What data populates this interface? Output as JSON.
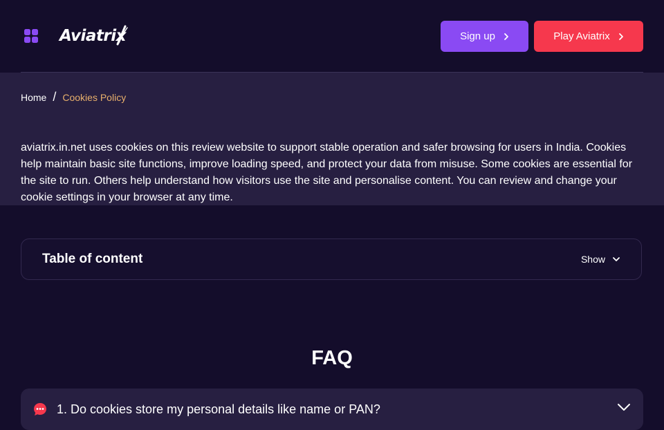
{
  "header": {
    "logo_text": "Aviatrix",
    "signup_label": "Sign up",
    "play_label": "Play Aviatrix"
  },
  "breadcrumb": {
    "home": "Home",
    "separator": "/",
    "current": "Cookies Policy"
  },
  "intro_text": "aviatrix.in.net uses cookies on this review website to support stable operation and safer browsing for users in India. Cookies help maintain basic site functions, improve loading speed, and protect your data from misuse. Some cookies are essential for the site to run. Others help understand how visitors use the site and personalise content. You can review and change your cookie settings in your browser at any time.",
  "toc": {
    "title": "Table of content",
    "toggle_label": "Show"
  },
  "faq": {
    "title": "FAQ",
    "items": [
      {
        "question": "1. Do cookies store my personal details like name or PAN?",
        "icon": "chat-bubble-icon"
      }
    ]
  },
  "colors": {
    "background": "#140d2b",
    "hero_background": "#271f41",
    "signup_button": "#8a4af3",
    "play_button": "#f6384d",
    "breadcrumb_current": "#e8b06c",
    "menu_icon": "#8a4af3",
    "faq_icon": "#f6384d"
  }
}
